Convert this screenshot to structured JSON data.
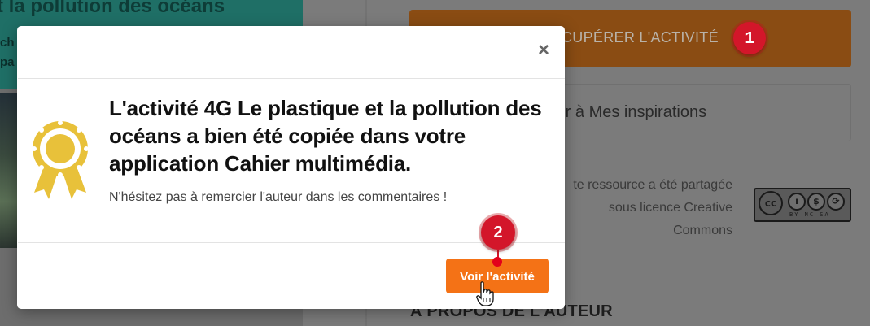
{
  "background": {
    "banner_title": "t la pollution des océans",
    "banner_sub1": "ch",
    "banner_sub2": "pa",
    "recover_button": "CUPÉRER L'ACTIVITÉ",
    "inspirations_button": "ter à Mes inspirations",
    "license_line1": "te ressource a été partagée",
    "license_line2": "sous licence Creative",
    "license_line3": "Commons",
    "cc_badge_tags": "BY NC SA",
    "author_heading": "À PROPOS DE L'AUTEUR"
  },
  "steps": {
    "step1": "1",
    "step2": "2"
  },
  "modal": {
    "close_label": "×",
    "title": "L'activité 4G Le plastique et la pollution des océans a bien été copiée dans votre application Cahier multimédia.",
    "subtitle": "N'hésitez pas à remercier l'auteur dans les commentaires !",
    "primary_button": "Voir l'activité",
    "icon": "award-ribbon-icon",
    "icon_color": "#e8c13a",
    "button_color": "#f47216"
  },
  "colors": {
    "overlay": "#7b7b7b",
    "step_marker": "#d3162a"
  }
}
